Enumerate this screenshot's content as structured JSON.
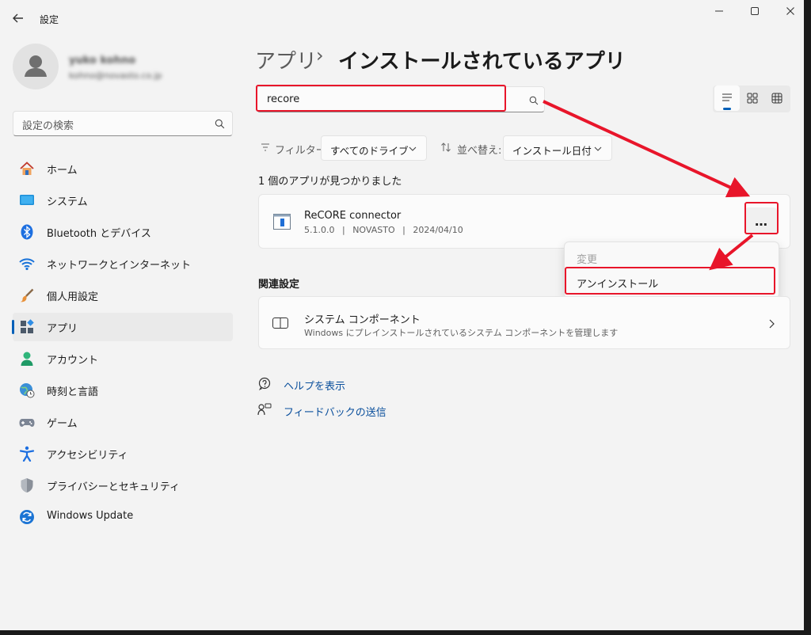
{
  "window": {
    "title": "設定",
    "back_icon": "arrow-left-icon",
    "controls": [
      "minimize-icon",
      "maximize-icon",
      "close-icon"
    ]
  },
  "user": {
    "name": "yuko kohno",
    "email": "kohno@novasto.co.jp"
  },
  "sidebar": {
    "search_placeholder": "設定の検索",
    "items": [
      {
        "label": "ホーム",
        "icon": "home-icon"
      },
      {
        "label": "システム",
        "icon": "display-icon"
      },
      {
        "label": "Bluetooth とデバイス",
        "icon": "bluetooth-icon"
      },
      {
        "label": "ネットワークとインターネット",
        "icon": "wifi-icon"
      },
      {
        "label": "個人用設定",
        "icon": "paintbrush-icon"
      },
      {
        "label": "アプリ",
        "icon": "apps-icon"
      },
      {
        "label": "アカウント",
        "icon": "person-icon"
      },
      {
        "label": "時刻と言語",
        "icon": "globe-clock-icon"
      },
      {
        "label": "ゲーム",
        "icon": "gamepad-icon"
      },
      {
        "label": "アクセシビリティ",
        "icon": "accessibility-icon"
      },
      {
        "label": "プライバシーとセキュリティ",
        "icon": "shield-icon"
      },
      {
        "label": "Windows Update",
        "icon": "refresh-icon"
      }
    ],
    "active": "アプリ"
  },
  "breadcrumb": {
    "parent": "アプリ",
    "separator": "›",
    "current": "インストールされているアプリ"
  },
  "search": {
    "value": "recore"
  },
  "filter": {
    "label": "フィルター:",
    "value": "すべてのドライブ",
    "sort_label": "並べ替え:",
    "sort_value": "インストール日付"
  },
  "results": {
    "count_text": "1 個のアプリが見つかりました"
  },
  "app": {
    "name": "ReCORE connector",
    "version": "5.1.0.0",
    "publisher": "NOVASTO",
    "date": "2024/04/10",
    "separator": "|",
    "more": "…"
  },
  "context_menu": {
    "items": [
      {
        "label": "変更",
        "enabled": false
      },
      {
        "label": "アンインストール",
        "enabled": true
      }
    ]
  },
  "related": {
    "heading": "関連設定",
    "title": "システム コンポーネント",
    "description": "Windows にプレインストールされているシステム コンポーネントを管理します"
  },
  "links": {
    "help": "ヘルプを表示",
    "feedback": "フィードバックの送信"
  },
  "colors": {
    "accent": "#005fb8",
    "annotation": "#e8152a"
  }
}
